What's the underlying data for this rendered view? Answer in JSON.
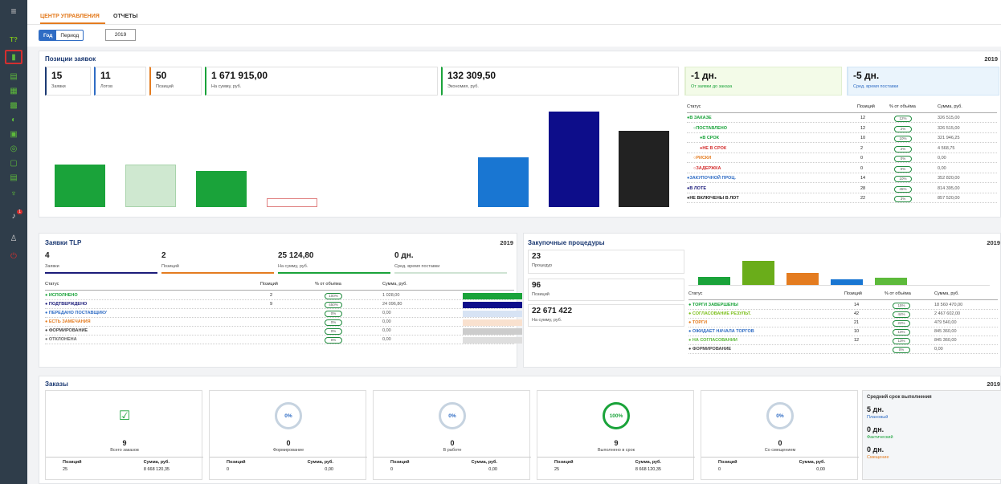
{
  "tabs": {
    "control": "ЦЕНТР УПРАВЛЕНИЯ",
    "reports": "ОТЧЕТЫ"
  },
  "period": {
    "year": "Год",
    "range": "Период",
    "value": "2019"
  },
  "sidebar": {
    "menu": "≡",
    "brand": "T?",
    "bell_count": "1"
  },
  "positions": {
    "title": "Позиции заявок",
    "year": "2019",
    "kpis": [
      {
        "value": "15",
        "label": "Заявки",
        "color": "#1c3a73"
      },
      {
        "value": "11",
        "label": "Лотов",
        "color": "#2f6cc4"
      },
      {
        "value": "50",
        "label": "Позиций",
        "color": "#e47c20"
      },
      {
        "value": "1 671 915,00",
        "label": "На сумму, руб.",
        "color": "#1aa33a"
      },
      {
        "value": "132 309,50",
        "label": "Экономия, руб.",
        "color": "#1aa33a"
      }
    ],
    "days1": {
      "value": "-1 дн.",
      "label": "От заявки до заказа"
    },
    "days2": {
      "value": "-5 дн.",
      "label": "Сред. время поставки"
    },
    "table": {
      "headers": [
        "Статус",
        "Позиций",
        "% от объёма",
        "Сумма, руб."
      ],
      "rows": [
        {
          "status": "В ЗАКАЗЕ",
          "dot": "●",
          "color": "#1aa33a",
          "pos": "12",
          "pct": "12%",
          "sum": "326 515,00",
          "indent": 0
        },
        {
          "status": "ПОСТАВЛЕНО",
          "dot": "○",
          "color": "#1aa33a",
          "pos": "12",
          "pct": "2%",
          "sum": "326 515,00",
          "indent": 1
        },
        {
          "status": "В СРОК",
          "dot": "●",
          "color": "#1aa33a",
          "pos": "10",
          "pct": "10%",
          "sum": "321 946,25",
          "indent": 2
        },
        {
          "status": "НЕ В СРОК",
          "dot": "●",
          "color": "#d32f2f",
          "pos": "2",
          "pct": "2%",
          "sum": "4 568,75",
          "indent": 2
        },
        {
          "status": "РИСКИ",
          "dot": "○",
          "color": "#e47c20",
          "pos": "0",
          "pct": "0%",
          "sum": "0,00",
          "indent": 1
        },
        {
          "status": "ЗАДЕРЖКА",
          "dot": "○",
          "color": "#d32f2f",
          "pos": "0",
          "pct": "0%",
          "sum": "0,00",
          "indent": 1
        },
        {
          "status": "ЗАКУПОЧНОЙ ПРОЦ.",
          "dot": "●",
          "color": "#2f6cc4",
          "pos": "14",
          "pct": "10%",
          "sum": "352 820,00",
          "indent": 0
        },
        {
          "status": "В ЛОТЕ",
          "dot": "●",
          "color": "#1c1c7a",
          "pos": "28",
          "pct": "45%",
          "sum": "814 395,00",
          "indent": 0
        },
        {
          "status": "НЕ ВКЛЮЧЕНЫ В ЛОТ",
          "dot": "●",
          "color": "#222222",
          "pos": "22",
          "pct": "3%",
          "sum": "857 520,00",
          "indent": 0
        }
      ]
    }
  },
  "tlp": {
    "title": "Заявки TLP",
    "year": "2019",
    "kpis": [
      {
        "value": "4",
        "label": "Заявки",
        "color": "#1c1c7a"
      },
      {
        "value": "2",
        "label": "Позиций",
        "color": "#e47c20"
      },
      {
        "value": "25 124,80",
        "label": "На сумму, руб.",
        "color": "#1aa33a"
      },
      {
        "value": "0 дн.",
        "label": "Сред. время поставки",
        "color": "#cfe3d3"
      }
    ],
    "table": {
      "headers": [
        "Статус",
        "Позиций",
        "% от объёма",
        "Сумма, руб."
      ],
      "rows": [
        {
          "status": "ИСПОЛНЕНО",
          "color": "#1aa33a",
          "pos": "2",
          "pct": "100%",
          "sum": "1 028,00",
          "bar": "#1aa33a"
        },
        {
          "status": "ПОДТВЕРЖДЕНО",
          "color": "#1c1c7a",
          "pos": "9",
          "pct": "450%",
          "sum": "24 096,80",
          "bar": "#0d0d8a"
        },
        {
          "status": "ПЕРЕДАНО ПОСТАВЩИКУ",
          "color": "#2f6cc4",
          "pos": "",
          "pct": "0%",
          "sum": "0,00",
          "bar": "#d7e3f4"
        },
        {
          "status": "ЕСТЬ ЗАМЕЧАНИЯ",
          "color": "#e47c20",
          "pos": "",
          "pct": "0%",
          "sum": "0,00",
          "bar": "#f9e1cf"
        },
        {
          "status": "ФОРМИРОВАНИЕ",
          "color": "#444444",
          "pos": "",
          "pct": "0%",
          "sum": "0,00",
          "bar": "#cccccc"
        },
        {
          "status": "ОТКЛОНЕНА",
          "color": "#666666",
          "pos": "",
          "pct": "0%",
          "sum": "0,00",
          "bar": "#dedede"
        }
      ]
    }
  },
  "procurement": {
    "title": "Закупочные процедуры",
    "year": "2019",
    "kpis": [
      {
        "value": "23",
        "label": "Процедур"
      },
      {
        "value": "96",
        "label": "Позиций"
      },
      {
        "value": "22 671 422",
        "label": "На сумму, руб."
      }
    ],
    "table": {
      "headers": [
        "Статус",
        "Позиций",
        "% от объёма",
        "Сумма, руб."
      ],
      "rows": [
        {
          "status": "ТОРГИ ЗАВЕРШЕНЫ",
          "color": "#1aa33a",
          "pos": "14",
          "pct": "15%",
          "sum": "18 560 470,00"
        },
        {
          "status": "СОГЛАСОВАНИЕ РЕЗУЛЬТ.",
          "color": "#7cbf1a",
          "pos": "42",
          "pct": "44%",
          "sum": "2 467 602,00"
        },
        {
          "status": "ТОРГИ",
          "color": "#e47c20",
          "pos": "21",
          "pct": "22%",
          "sum": "479 540,00"
        },
        {
          "status": "ОЖИДАЕТ НАЧАЛА ТОРГОВ",
          "color": "#2f6cc4",
          "pos": "10",
          "pct": "10%",
          "sum": "845 360,00"
        },
        {
          "status": "НА СОГЛАСОВАНИИ",
          "color": "#5dba3b",
          "pos": "12",
          "pct": "13%",
          "sum": "845 360,00"
        },
        {
          "status": "ФОРМИРОВАНИЕ",
          "color": "#444444",
          "pos": "",
          "pct": "0%",
          "sum": "0,00"
        }
      ]
    }
  },
  "orders": {
    "title": "Заказы",
    "year": "2019",
    "pos_label": "Позиций",
    "sum_label": "Сумма, руб.",
    "cards": [
      {
        "ring": "check",
        "value": "9",
        "label": "Всего заказов",
        "pos": "25",
        "sum": "8 668 120,35"
      },
      {
        "ring": "0%",
        "value": "0",
        "label": "Формирование",
        "pos": "0",
        "sum": "0,00"
      },
      {
        "ring": "0%",
        "value": "0",
        "label": "В работе",
        "pos": "0",
        "sum": "0,00"
      },
      {
        "ring": "100%",
        "value": "9",
        "label": "Выполнено в срок",
        "pos": "25",
        "sum": "8 668 120,35"
      },
      {
        "ring": "0%",
        "value": "0",
        "label": "Со смещением",
        "pos": "0",
        "sum": "0,00"
      }
    ],
    "avg": {
      "title": "Средний срок выполнения",
      "items": [
        {
          "value": "5 дн.",
          "label": "Плановый",
          "color": "#2f6cc4"
        },
        {
          "value": "0 дн.",
          "label": "Фактический",
          "color": "#1aa33a"
        },
        {
          "value": "0 дн.",
          "label": "Смещение",
          "color": "#e47c20"
        }
      ]
    }
  },
  "chart_data": [
    {
      "type": "bar",
      "categories": [
        "Заявки",
        "Лотов",
        "Позиций",
        "На сумму",
        "Экономия",
        "В заказе",
        "В лоте",
        "Не включены"
      ],
      "values": [
        0.33,
        0.33,
        0.28,
        0.06,
        0.38,
        0.58,
        0.58,
        0.5
      ],
      "colors": [
        "#1aa33a",
        "#cfe8d0",
        "#1aa33a",
        "#ffffff",
        "#1976d2",
        "#0d0d8a",
        "#222222",
        "#222222"
      ]
    },
    {
      "type": "bar",
      "categories": [
        "ТОРГИ ЗАВЕРШЕНЫ",
        "СОГЛАСОВАНИЕ РЕЗУЛЬТ.",
        "ТОРГИ",
        "ОЖИДАЕТ НАЧАЛА ТОРГОВ",
        "НА СОГЛАСОВАНИИ"
      ],
      "values": [
        14,
        42,
        21,
        10,
        12
      ],
      "colors": [
        "#1aa33a",
        "#6aad1a",
        "#e47c20",
        "#1976d2",
        "#5dba3b"
      ]
    }
  ]
}
